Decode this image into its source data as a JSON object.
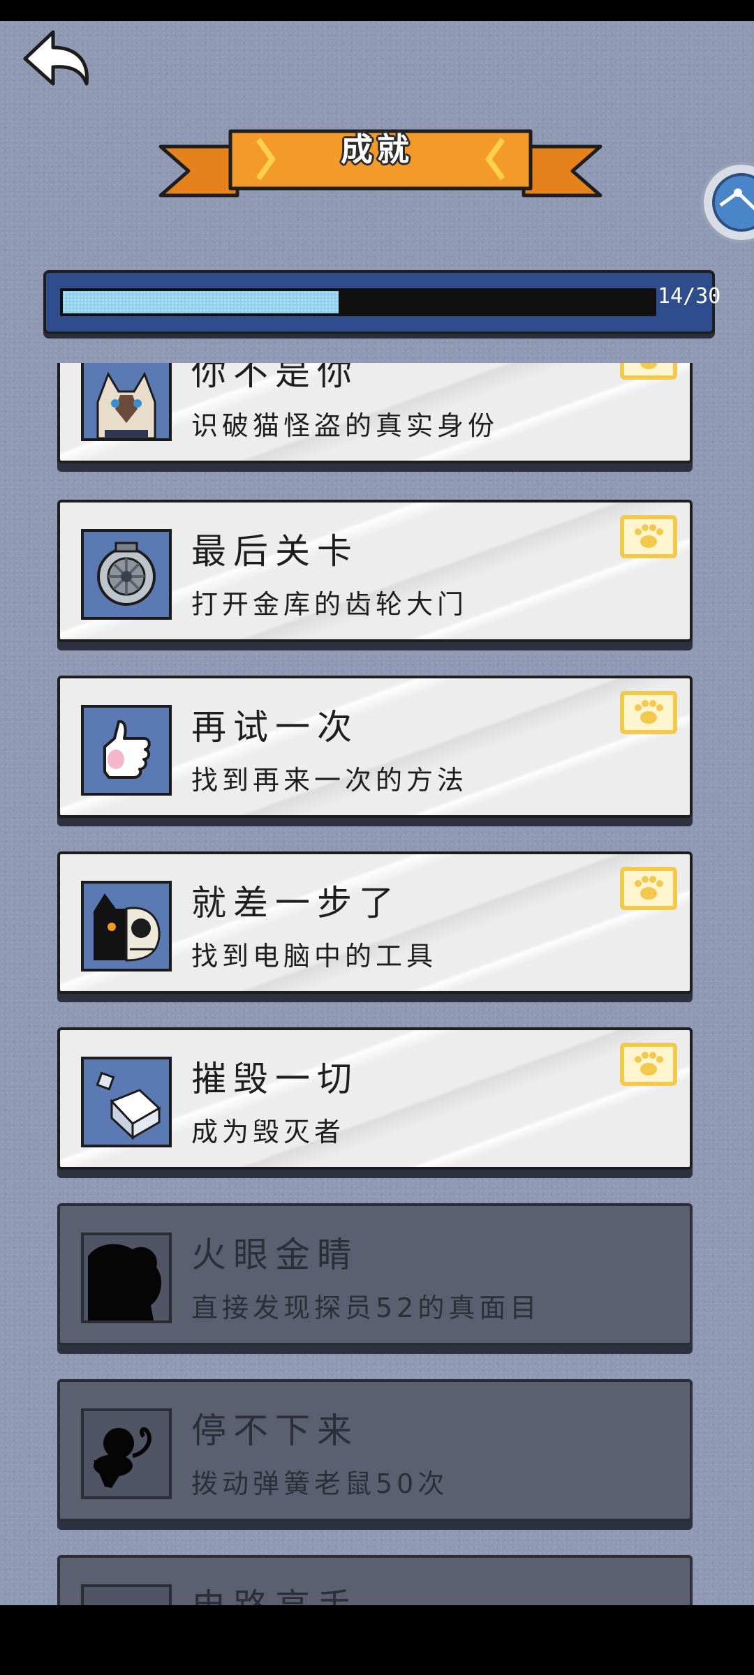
{
  "header": {
    "title": "成就"
  },
  "progress": {
    "label": "14/30",
    "fraction": 0.4667
  },
  "achievements": [
    {
      "title": "你不是你",
      "description": "识破猫怪盗的真实身份",
      "status": "unlocked",
      "icon": "siamese-cat-icon"
    },
    {
      "title": "最后关卡",
      "description": "打开金库的齿轮大门",
      "status": "unlocked",
      "icon": "vault-gear-icon"
    },
    {
      "title": "再试一次",
      "description": "找到再来一次的方法",
      "status": "unlocked",
      "icon": "thumbs-up-icon"
    },
    {
      "title": "就差一步了",
      "description": "找到电脑中的工具",
      "status": "unlocked",
      "icon": "cat-skull-icon"
    },
    {
      "title": "摧毁一切",
      "description": "成为毁灭者",
      "status": "unlocked",
      "icon": "cubes-icon"
    },
    {
      "title": "火眼金睛",
      "description": "直接发现探员52的真面目",
      "status": "locked",
      "icon": "silhouette-icon"
    },
    {
      "title": "停不下来",
      "description": "拨动弹簧老鼠50次",
      "status": "locked",
      "icon": "mouse-silhouette-icon"
    },
    {
      "title": "电路高手",
      "description": "",
      "status": "locked",
      "icon": "silhouette-icon"
    }
  ],
  "colors": {
    "background": "#8f99b3",
    "banner": "#f39a2b",
    "progress_frame": "#2f4c8c",
    "progress_fill": "#8fd0ec",
    "stamp": "#f2c94c",
    "thumb": "#5b79b3"
  }
}
